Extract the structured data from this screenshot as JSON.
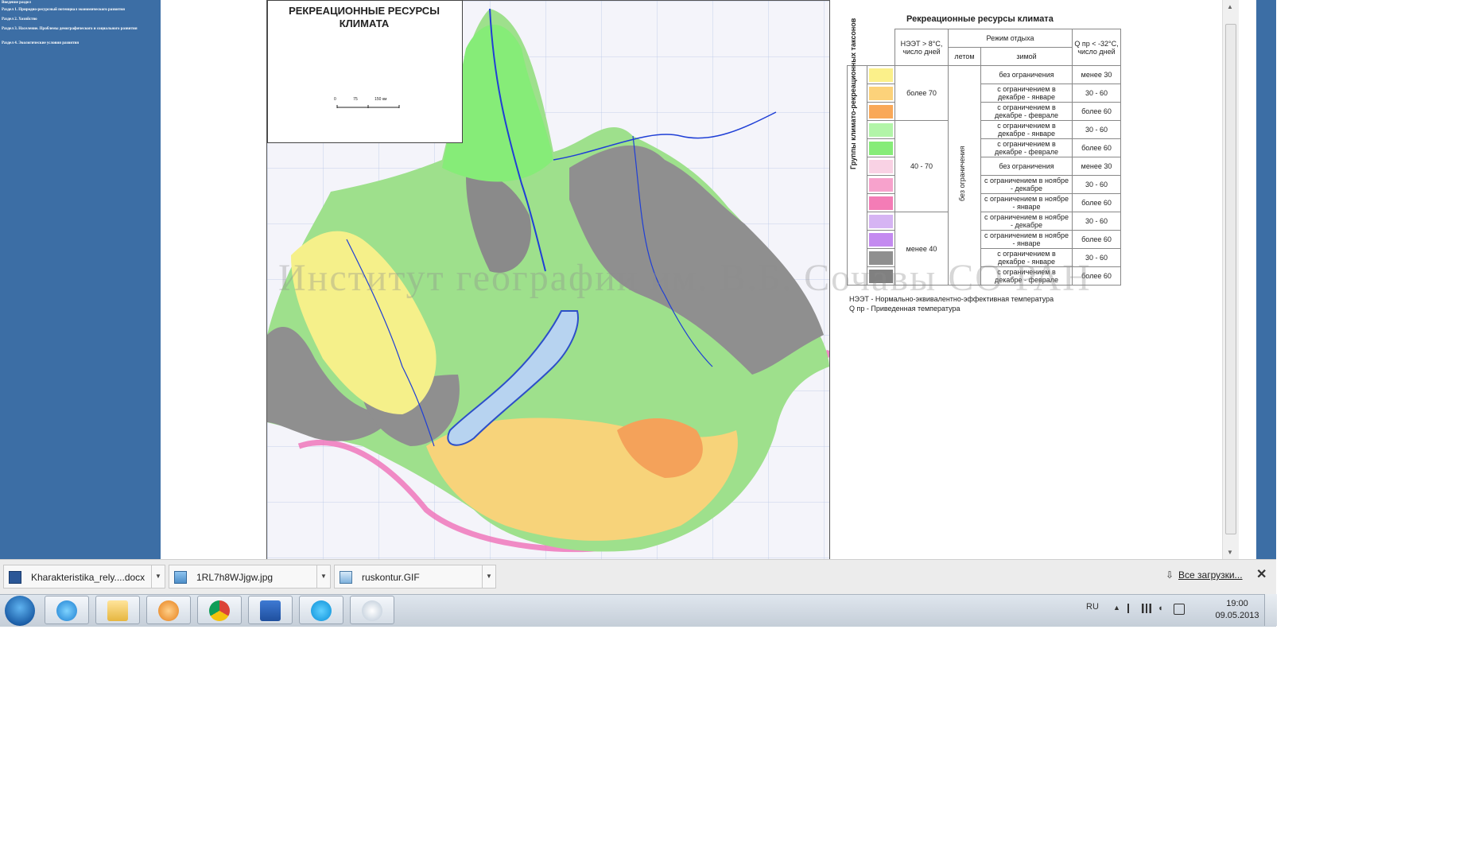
{
  "sidebar": {
    "items": [
      "Введение раздел",
      "Раздел 1. Природно-ресурсный потенциал экономического развития",
      "Раздел 2. Хозяйство",
      "Раздел 3. Население. Проблемы демографического и социального развития",
      "Раздел 4. Экологические условия развития"
    ]
  },
  "map": {
    "title": "РЕКРЕАЦИОННЫЕ РЕСУРСЫ КЛИМАТА",
    "scale": [
      "0",
      "75",
      "150 км"
    ],
    "watermark": "Институт географии им. В.Б. Сочавы СО РАН"
  },
  "legend": {
    "title": "Рекреационные ресурсы климата",
    "header_neet": "НЭЭТ > 8°С, число дней",
    "header_mode": "Режим отдыха",
    "header_summer": "летом",
    "header_winter": "зимой",
    "header_q": "Q пр < -32°С, число дней",
    "side_label": "Группы климато-рекреационных таксонов",
    "summer_value": "без ограничения",
    "groups": [
      "более 70",
      "40 - 70",
      "менее 40"
    ],
    "rows": [
      {
        "color": "#fbf08a",
        "winter": "без ограничения",
        "q": "менее 30"
      },
      {
        "color": "#fcd27a",
        "winter": "с ограничением в декабре - январе",
        "q": "30 - 60"
      },
      {
        "color": "#f9a858",
        "winter": "с ограничением в декабре - феврале",
        "q": "более 60"
      },
      {
        "color": "#b2f5a8",
        "winter": "с ограничением в декабре - январе",
        "q": "30 - 60"
      },
      {
        "color": "#86ec78",
        "winter": "с ограничением в декабре - феврале",
        "q": "более 60"
      },
      {
        "color": "#f9d2e4",
        "winter": "без ограничения",
        "q": "менее 30"
      },
      {
        "color": "#f7a2cc",
        "winter": "с ограничением в ноябре - декабре",
        "q": "30 - 60"
      },
      {
        "color": "#f47cb6",
        "winter": "с ограничением в ноябре - январе",
        "q": "более 60"
      },
      {
        "color": "#d6b4f3",
        "winter": "с ограничением в ноябре - декабре",
        "q": "30 - 60"
      },
      {
        "color": "#c48af0",
        "winter": "с ограничением в ноябре - январе",
        "q": "более 60"
      },
      {
        "color": "#8f8f8f",
        "winter": "с ограничением в декабре - январе",
        "q": "30 - 60"
      },
      {
        "color": "#808080",
        "winter": "с ограничением в декабре - феврале",
        "q": "более 60"
      }
    ],
    "note1": "НЭЭТ - Нормально-эквивалентно-эффективная температура",
    "note2": "Q пр - Приведенная температура"
  },
  "downloads": {
    "items": [
      {
        "name": "Kharakteristika_rely....docx",
        "icon": "word-doc-icon"
      },
      {
        "name": "1RL7h8WJjgw.jpg",
        "icon": "image-file-icon"
      },
      {
        "name": "ruskontur.GIF",
        "icon": "image-file-icon"
      }
    ],
    "all_label": "Все загрузки..."
  },
  "taskbar": {
    "apps": [
      "internet-explorer-icon",
      "file-explorer-icon",
      "media-player-icon",
      "chrome-icon",
      "word-icon",
      "skype-icon",
      "paint-icon"
    ],
    "lang": "RU",
    "time": "19:00",
    "date": "09.05.2013"
  },
  "colors": {
    "panel_blue": "#3c6ea5",
    "river_blue": "#1f3fd6",
    "border_pink": "#ef6fb8"
  }
}
